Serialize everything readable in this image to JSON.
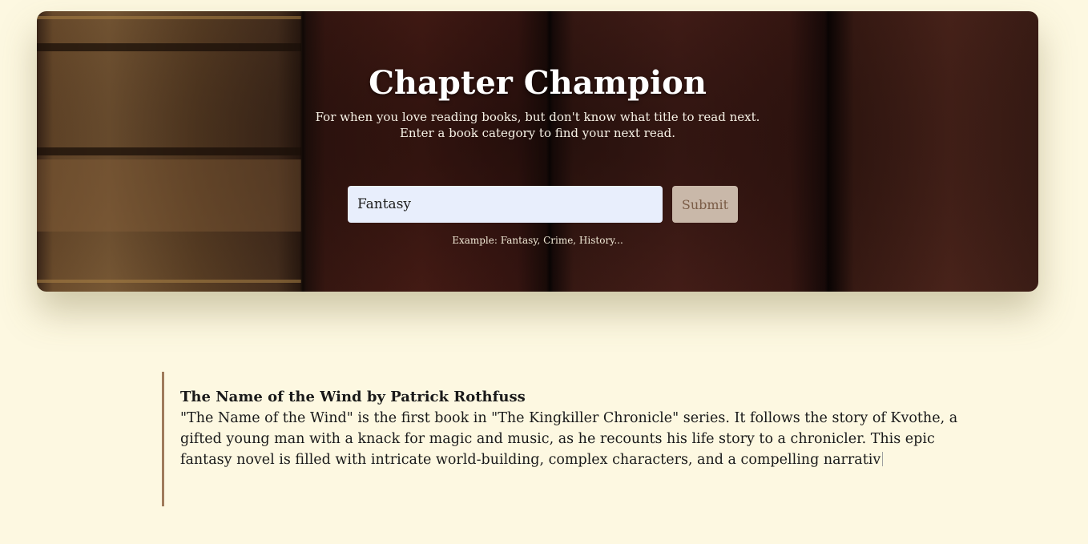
{
  "hero": {
    "title": "Chapter Champion",
    "subtitle_line1": "For when you love reading books, but don't know what title to read next.",
    "subtitle_line2": "Enter a book category to find your next read."
  },
  "search": {
    "value": "Fantasy",
    "submit_label": "Submit",
    "hint": "Example: Fantasy, Crime, History..."
  },
  "result": {
    "title": "The Name of the Wind by Patrick Rothfuss",
    "description": "\"The Name of the Wind\" is the first book in \"The Kingkiller Chronicle\" series. It follows the story of Kvothe, a gifted young man with a knack for magic and music, as he recounts his life story to a chronicler. This epic fantasy novel is filled with intricate world-building, complex characters, and a compelling narrativ"
  },
  "colors": {
    "page_background": "#fdf8e1",
    "input_background": "#e8eefc",
    "submit_background": "#c9b8a9",
    "result_border": "#a07b5b"
  }
}
